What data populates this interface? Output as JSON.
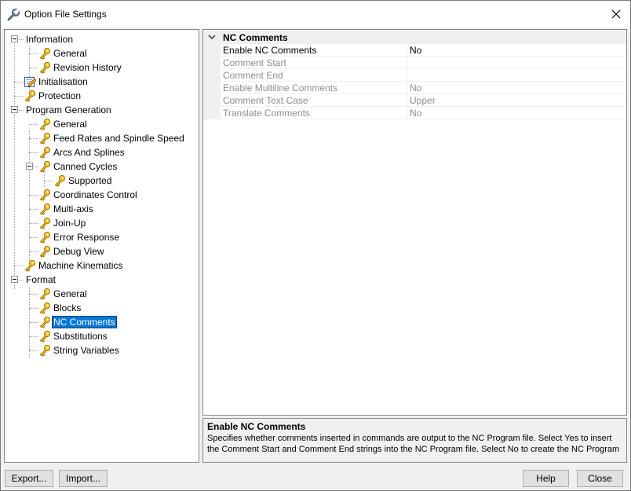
{
  "window": {
    "title": "Option File Settings",
    "accent": "#0078d7"
  },
  "tree": {
    "items": [
      {
        "label": "Information",
        "icon": "none",
        "expanded": true
      },
      {
        "label": "General",
        "icon": "key-icon"
      },
      {
        "label": "Revision History",
        "icon": "key-icon"
      },
      {
        "label": "Initialisation",
        "icon": "edit-document-icon"
      },
      {
        "label": "Protection",
        "icon": "key-icon"
      },
      {
        "label": "Program Generation",
        "icon": "none",
        "expanded": true
      },
      {
        "label": "General",
        "icon": "key-icon"
      },
      {
        "label": "Feed Rates and Spindle Speed",
        "icon": "key-icon"
      },
      {
        "label": "Arcs And Splines",
        "icon": "key-icon"
      },
      {
        "label": "Canned Cycles",
        "icon": "key-icon",
        "expanded": true
      },
      {
        "label": "Supported",
        "icon": "key-icon"
      },
      {
        "label": "Coordinates Control",
        "icon": "key-icon"
      },
      {
        "label": "Multi-axis",
        "icon": "key-icon"
      },
      {
        "label": "Join-Up",
        "icon": "key-icon"
      },
      {
        "label": "Error Response",
        "icon": "key-icon"
      },
      {
        "label": "Debug View",
        "icon": "key-icon"
      },
      {
        "label": "Machine Kinematics",
        "icon": "key-icon"
      },
      {
        "label": "Format",
        "icon": "none",
        "expanded": true
      },
      {
        "label": "General",
        "icon": "key-icon"
      },
      {
        "label": "Blocks",
        "icon": "key-icon"
      },
      {
        "label": "NC Comments",
        "icon": "key-icon",
        "selected": true
      },
      {
        "label": "Substitutions",
        "icon": "key-icon"
      },
      {
        "label": "String Variables",
        "icon": "key-icon"
      }
    ]
  },
  "grid": {
    "category": "NC Comments",
    "rows": [
      {
        "name": "Enable NC Comments",
        "value": "No",
        "enabled": true
      },
      {
        "name": "Comment Start",
        "value": "",
        "enabled": false
      },
      {
        "name": "Comment End",
        "value": "",
        "enabled": false
      },
      {
        "name": "Enable Multiline Comments",
        "value": "No",
        "enabled": false
      },
      {
        "name": "Comment Text Case",
        "value": "Upper",
        "enabled": false
      },
      {
        "name": "Translate Comments",
        "value": "No",
        "enabled": false
      }
    ]
  },
  "description": {
    "title": "Enable NC Comments",
    "text": "Specifies whether comments inserted in commands are output to the NC Program file. Select Yes to insert the Comment Start and Comment End strings into the NC Program file. Select No to create the NC Program file wit..."
  },
  "buttons": {
    "export": "Export...",
    "import": "Import...",
    "help": "Help",
    "close": "Close"
  }
}
